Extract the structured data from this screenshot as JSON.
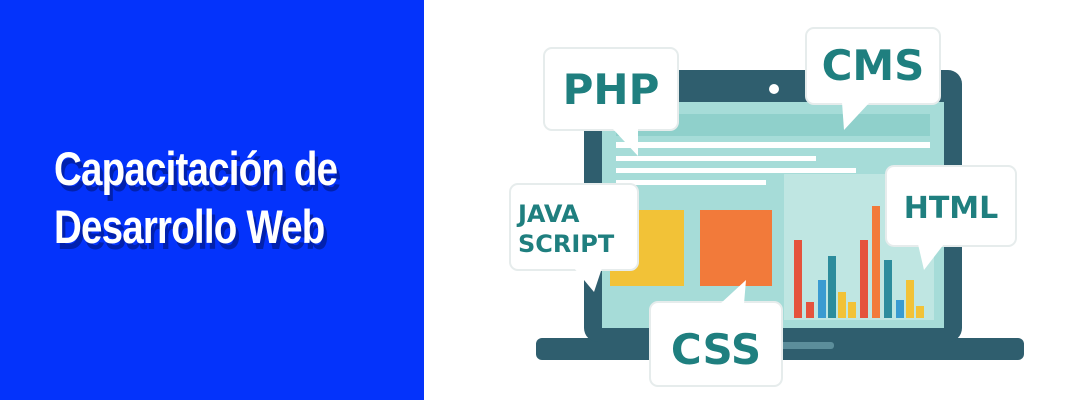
{
  "banner": {
    "title_line1": "Capacitación de",
    "title_line2": "Desarrollo Web",
    "background_color": "#0433fb"
  },
  "illustration": {
    "labels": {
      "php": "PHP",
      "cms": "CMS",
      "html": "HTML",
      "javascript_line1": "JAVA",
      "javascript_line2": "SCRIPT",
      "css": "CSS"
    },
    "icon": "laptop-icon",
    "colors": {
      "laptop_frame": "#2f5e6e",
      "screen": "#a6dcd8",
      "accent_text": "#1f7f7f",
      "yellow_block": "#f2c237",
      "orange_block": "#f27a3a",
      "bar_red": "#e5533d",
      "bar_teal": "#2c8c9c",
      "bar_blue": "#3a9bd1",
      "bar_yellow": "#f2c237"
    }
  }
}
